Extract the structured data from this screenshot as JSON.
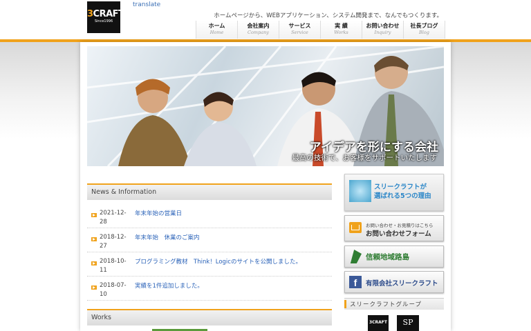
{
  "header": {
    "logo_main": "CRAFT",
    "logo_num": "3",
    "logo_sub": "Since1996",
    "translate": "translate",
    "tagline": "ホームページから、WEBアプリケーション、システム開発まで、なんでもつくります。"
  },
  "nav": [
    {
      "ja": "ホーム",
      "en": "Home"
    },
    {
      "ja": "会社案内",
      "en": "Company"
    },
    {
      "ja": "サービス",
      "en": "Service"
    },
    {
      "ja": "実 績",
      "en": "Works"
    },
    {
      "ja": "お問い合わせ",
      "en": "Inquiry"
    },
    {
      "ja": "社長ブログ",
      "en": "Blog"
    }
  ],
  "hero": {
    "title": "アイデアを形にする会社",
    "subtitle": "最高の技術で、お客様をサポートいたします"
  },
  "news": {
    "heading": "News & Information",
    "items": [
      {
        "date": "2021-12-28",
        "title": "年末年始の営業日"
      },
      {
        "date": "2018-12-27",
        "title": "年末年始　休業のご案内"
      },
      {
        "date": "2018-10-11",
        "title": "プログラミング教材　Think！Logicのサイトを公開しました。"
      },
      {
        "date": "2018-07-10",
        "title": "実績を1件追加しました。"
      }
    ]
  },
  "works": {
    "heading": "Works"
  },
  "sidebar": {
    "reasons_line1": "スリークラフトが",
    "reasons_line2": "選ばれる5つの理由",
    "inquiry_small": "お問い合わせ・お見積りはこちら",
    "inquiry_label": "お問い合わせフォーム",
    "local_label": "信頼地域路島",
    "facebook_label": "有限会社スリークラフト",
    "group_heading": "スリークラフトグループ",
    "group_logo1": "3CRAFT",
    "group_logo2": "SP"
  },
  "colors": {
    "accent": "#f0a21b",
    "link": "#2a62b8"
  }
}
